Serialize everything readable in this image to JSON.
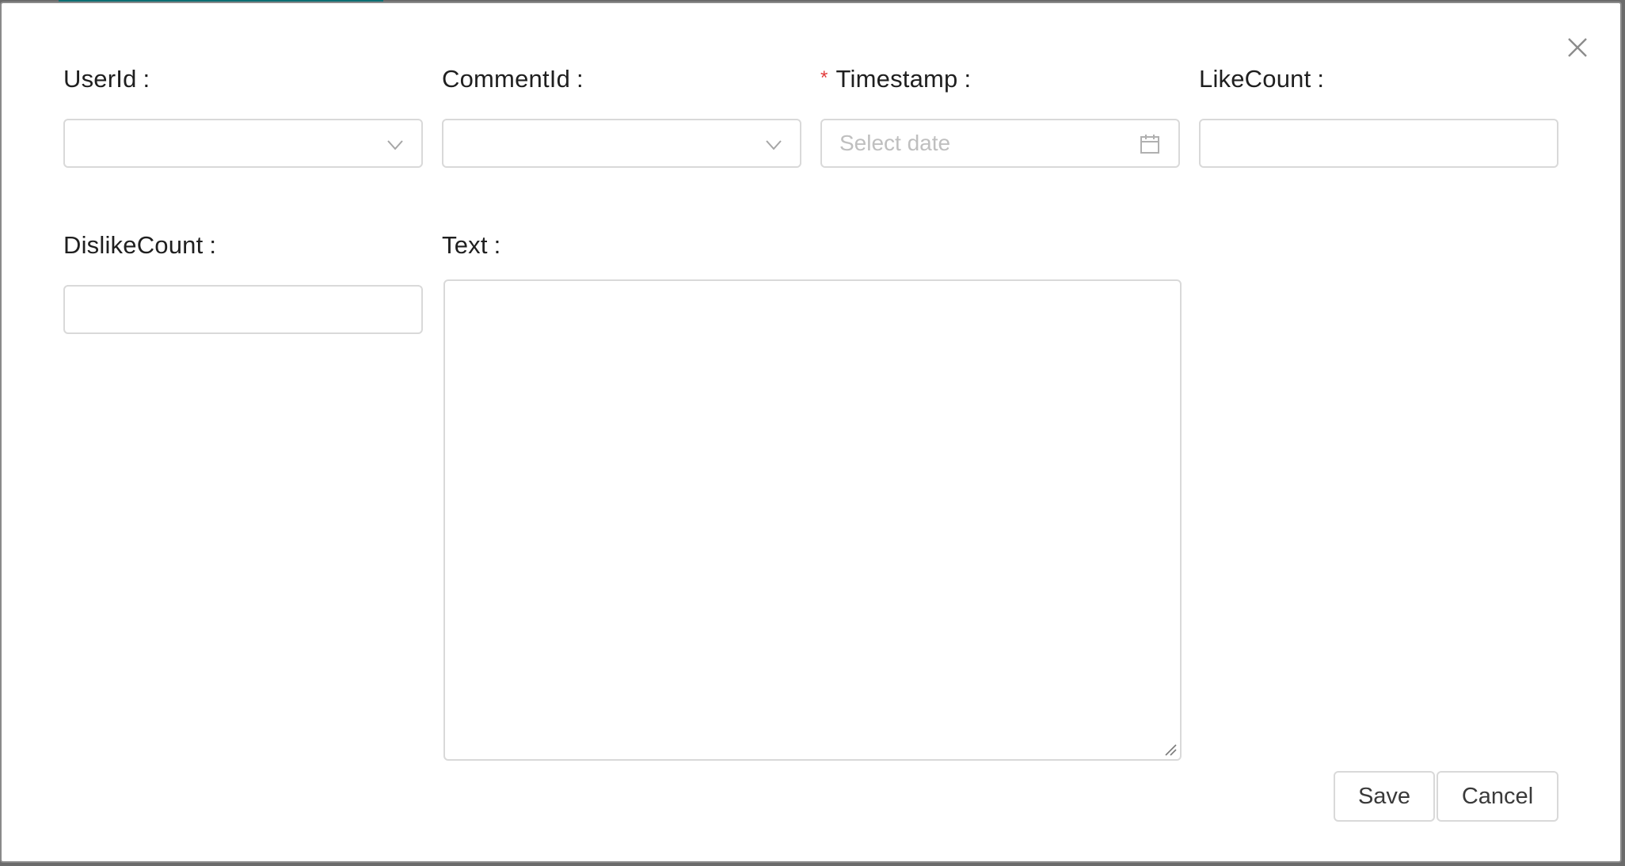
{
  "form": {
    "fields": {
      "userid": {
        "label": "UserId",
        "value": ""
      },
      "commentid": {
        "label": "CommentId",
        "value": ""
      },
      "timestamp": {
        "label": "Timestamp",
        "required_mark": "*",
        "placeholder": "Select date",
        "value": ""
      },
      "likecount": {
        "label": "LikeCount",
        "value": ""
      },
      "dislikecount": {
        "label": "DislikeCount",
        "value": ""
      },
      "text": {
        "label": "Text",
        "value": ""
      }
    },
    "colon": ":"
  },
  "buttons": {
    "save_label": "Save",
    "cancel_label": "Cancel"
  },
  "icons": {
    "close": "close-icon",
    "select_arrow": "chevron-down-icon",
    "calendar": "calendar-icon",
    "resize": "resize-handle-icon"
  },
  "colors": {
    "required": "#e23b3b",
    "border": "#d9d9d9",
    "accent": "#0b6e72"
  }
}
